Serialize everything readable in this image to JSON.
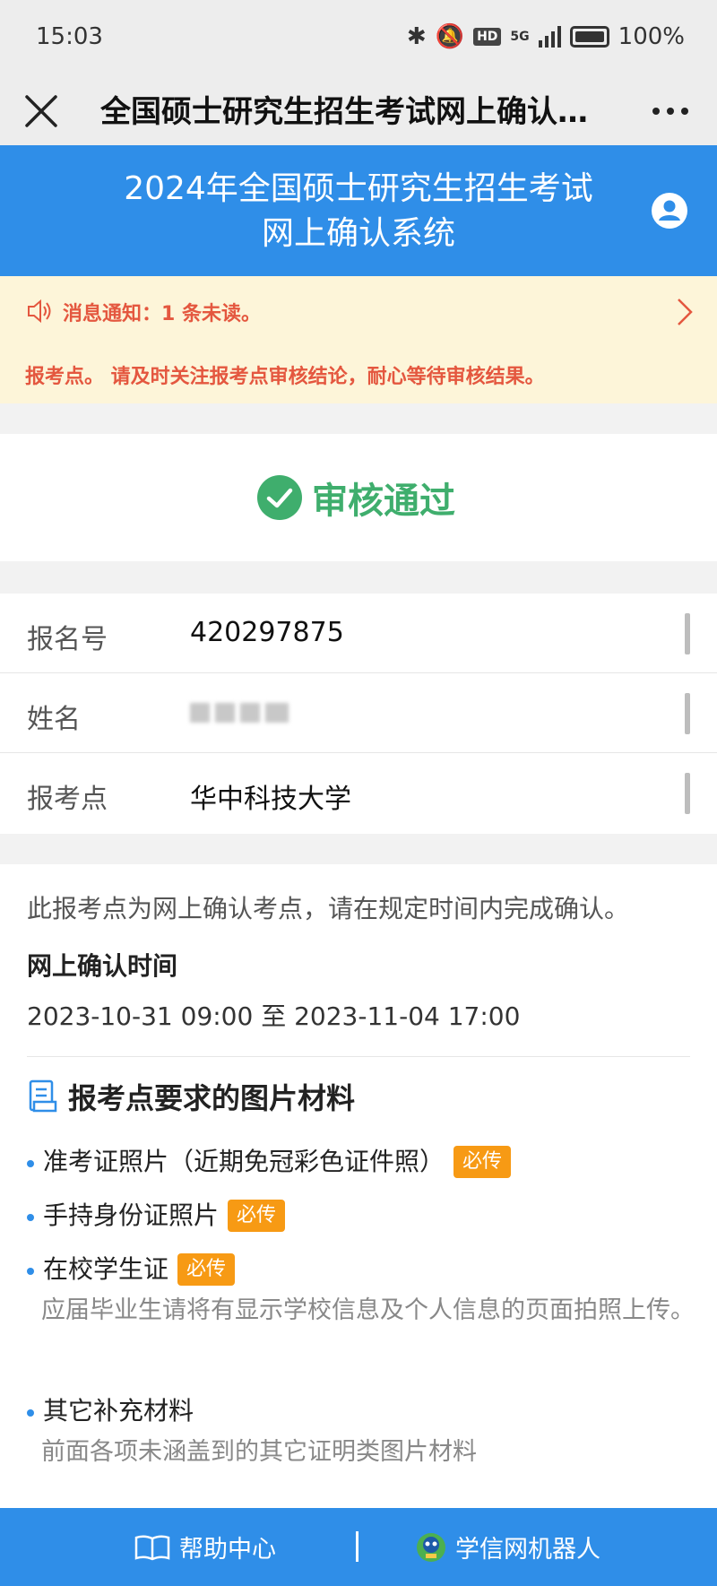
{
  "status_bar": {
    "time": "15:03",
    "hd": "HD",
    "network": "5G",
    "battery": "100%"
  },
  "nav": {
    "title": "全国硕士研究生招生考试网上确认系..."
  },
  "header": {
    "title_line1": "2024年全国硕士研究生招生考试",
    "title_line2": "网上确认系统"
  },
  "notice": {
    "line1": "消息通知：1 条未读。",
    "line2": "报考点。 请及时关注报考点审核结论，耐心等待审核结果。"
  },
  "review": {
    "status": "审核通过",
    "status_color": "#3fae6d"
  },
  "info": {
    "rows": [
      {
        "label": "报名号",
        "value": "420297875"
      },
      {
        "label": "姓名",
        "value": ""
      },
      {
        "label": "报考点",
        "value": "华中科技大学"
      }
    ]
  },
  "details": {
    "desc": "此报考点为网上确认考点，请在规定时间内完成确认。",
    "time_heading": "网上确认时间",
    "time_range": "2023-10-31 09:00 至 2023-11-04 17:00",
    "materials_title": "报考点要求的图片材料",
    "materials": [
      {
        "name": "准考证照片（近期免冠彩色证件照）",
        "badge": "必传",
        "note": ""
      },
      {
        "name": "手持身份证照片",
        "badge": "必传",
        "note": ""
      },
      {
        "name": "在校学生证",
        "badge": "必传",
        "note": "应届毕业生请将有显示学校信息及个人信息的页面拍照上传。"
      },
      {
        "name": "其它补充材料",
        "badge": "",
        "note": "前面各项未涵盖到的其它证明类图片材料"
      }
    ]
  },
  "bottom": {
    "help": "帮助中心",
    "robot": "学信网机器人"
  },
  "colors": {
    "primary": "#2f8ee8",
    "notice_text": "#e4573f",
    "badge": "#f79a14"
  }
}
